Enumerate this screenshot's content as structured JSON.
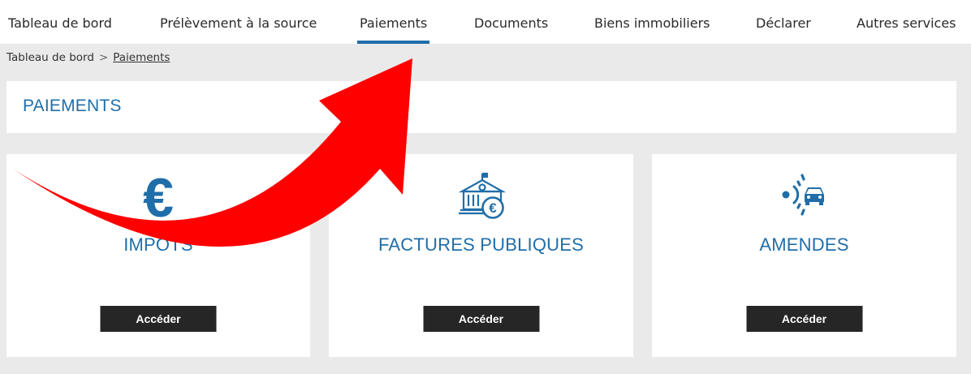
{
  "nav": {
    "items": [
      {
        "label": "Tableau de bord"
      },
      {
        "label": "Prélèvement à la source"
      },
      {
        "label": "Paiements"
      },
      {
        "label": "Documents"
      },
      {
        "label": "Biens immobiliers"
      },
      {
        "label": "Déclarer"
      },
      {
        "label": "Autres services"
      }
    ],
    "active": "Paiements"
  },
  "breadcrumb": {
    "home": "Tableau de bord",
    "separator": ">",
    "current": "Paiements"
  },
  "page_title": "PAIEMENTS",
  "cards": [
    {
      "icon": "euro-icon",
      "title": "IMPÔTS",
      "button": "Accéder"
    },
    {
      "icon": "public-building-euro-icon",
      "title": "FACTURES PUBLIQUES",
      "button": "Accéder"
    },
    {
      "icon": "speed-camera-car-icon",
      "title": "AMENDES",
      "button": "Accéder"
    }
  ],
  "overlay": {
    "icon": "red-curved-arrow-icon"
  },
  "colors": {
    "accent": "#1f6ea9",
    "background": "#ebeaea",
    "button": "#262627",
    "arrow": "#ff0000"
  }
}
